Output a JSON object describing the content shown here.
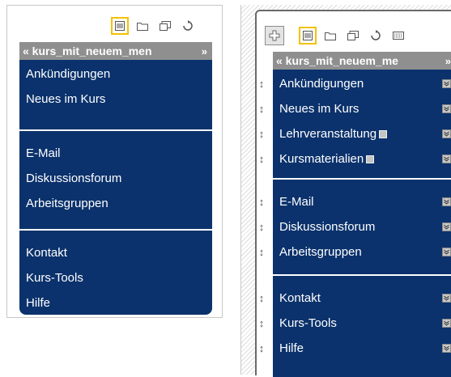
{
  "left": {
    "toolbar": {
      "icons": [
        "list-icon",
        "folder-icon",
        "window-icon",
        "refresh-icon"
      ]
    },
    "header": {
      "title": "« kurs_mit_neuem_men",
      "arrow": "»"
    },
    "groups": [
      {
        "items": [
          "Ankündigungen",
          "Neues im Kurs"
        ]
      },
      {
        "items": [
          "E-Mail",
          "Diskussionsforum",
          "Arbeitsgruppen"
        ]
      },
      {
        "items": [
          "Kontakt",
          "Kurs-Tools",
          "Hilfe"
        ]
      }
    ]
  },
  "right": {
    "toolbar": {
      "icons": [
        "add-icon",
        "list-icon",
        "folder-icon",
        "window-icon",
        "refresh-icon",
        "keyboard-icon"
      ]
    },
    "header": {
      "title": "« kurs_mit_neuem_me",
      "arrow": "»"
    },
    "groups": [
      {
        "items": [
          "Ankündigungen",
          "Neues im Kurs",
          "Lehrveranstaltung",
          "Kursmaterialien"
        ]
      },
      {
        "items": [
          "E-Mail",
          "Diskussionsforum",
          "Arbeitsgruppen"
        ]
      },
      {
        "items": [
          "Kontakt",
          "Kurs-Tools",
          "Hilfe"
        ]
      }
    ]
  },
  "colors": {
    "menu_bg": "#0b326c",
    "header_bg": "#8f8f8f",
    "active_outline": "#f2c200"
  }
}
